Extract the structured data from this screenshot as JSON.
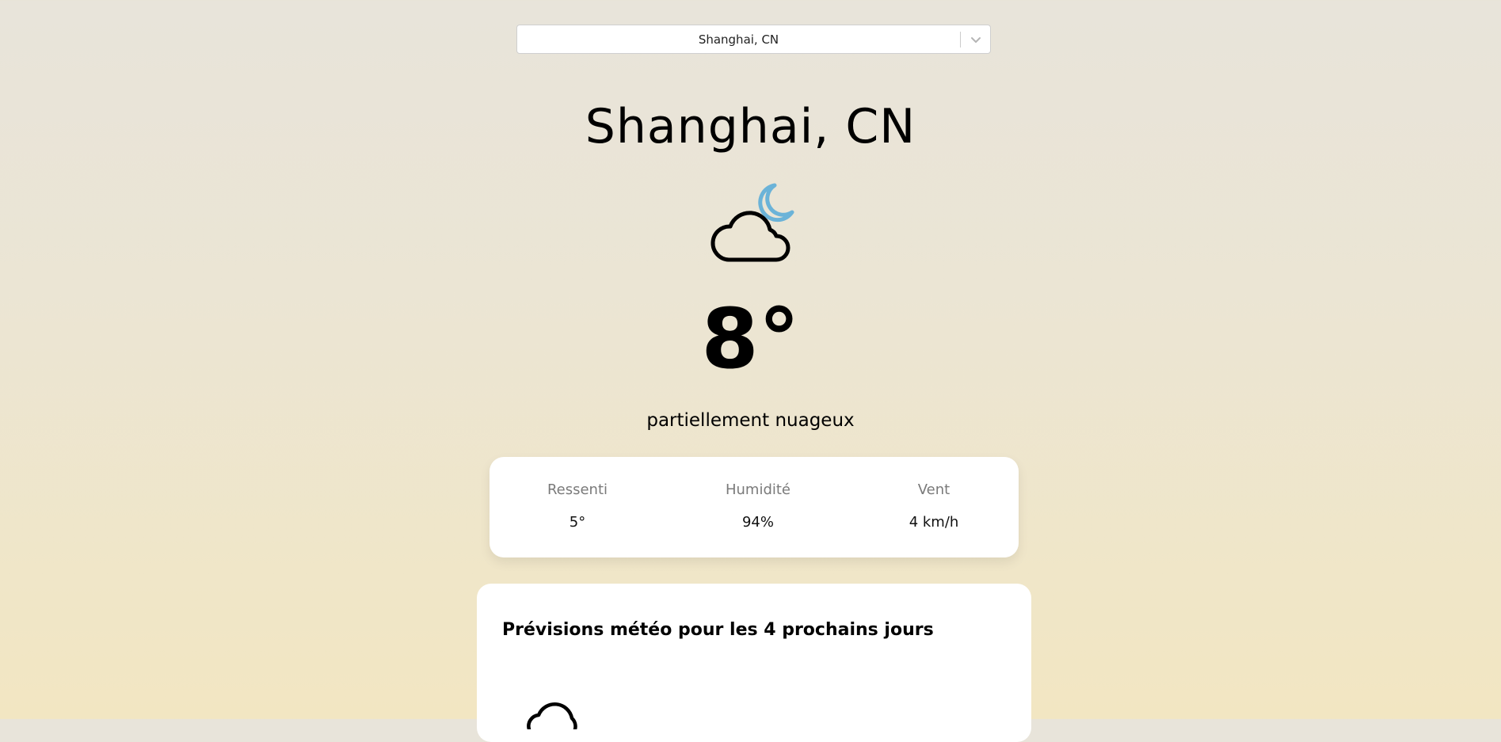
{
  "city_select": {
    "selected": "Shanghai, CN"
  },
  "current": {
    "city": "Shanghai, CN",
    "icon": "cloud-moon-icon",
    "temperature": "8°",
    "description": "partiellement nuageux"
  },
  "details": [
    {
      "label": "Ressenti",
      "value": "5°"
    },
    {
      "label": "Humidité",
      "value": "94%"
    },
    {
      "label": "Vent",
      "value": "4 km/h"
    }
  ],
  "forecast": {
    "title": "Prévisions météo pour les 4 prochains jours",
    "first_icon": "cloud-icon"
  },
  "colors": {
    "moon": "#6bb3d8",
    "card": "#ffffff",
    "label": "#7a7a7a"
  }
}
